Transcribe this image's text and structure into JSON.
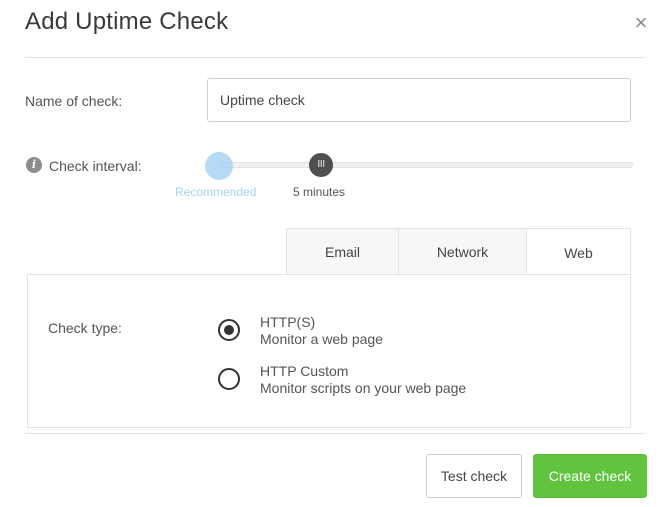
{
  "dialog": {
    "title": "Add Uptime Check",
    "close_glyph": "×"
  },
  "name_field": {
    "label": "Name of check:",
    "value": "Uptime check"
  },
  "interval": {
    "info_glyph": "i",
    "label": "Check interval:",
    "knob_glyph": "III",
    "recommended_label": "Recommended",
    "value_label": "5 minutes"
  },
  "tabs": [
    {
      "label": "Email",
      "active": false
    },
    {
      "label": "Network",
      "active": false
    },
    {
      "label": "Web",
      "active": true
    }
  ],
  "check_type": {
    "label": "Check type:",
    "options": [
      {
        "title": "HTTP(S)",
        "description": "Monitor a web page",
        "selected": true
      },
      {
        "title": "HTTP Custom",
        "description": "Monitor scripts on your web page",
        "selected": false
      }
    ]
  },
  "footer": {
    "test_label": "Test check",
    "create_label": "Create check"
  },
  "colors": {
    "accent_green": "#62c33f",
    "recommended_blue": "#a9d4f4",
    "knob_dark": "#4f4f4f"
  },
  "icons": {
    "close": "close-icon",
    "info": "info-icon",
    "slider_knob": "slider-grip-icon"
  }
}
